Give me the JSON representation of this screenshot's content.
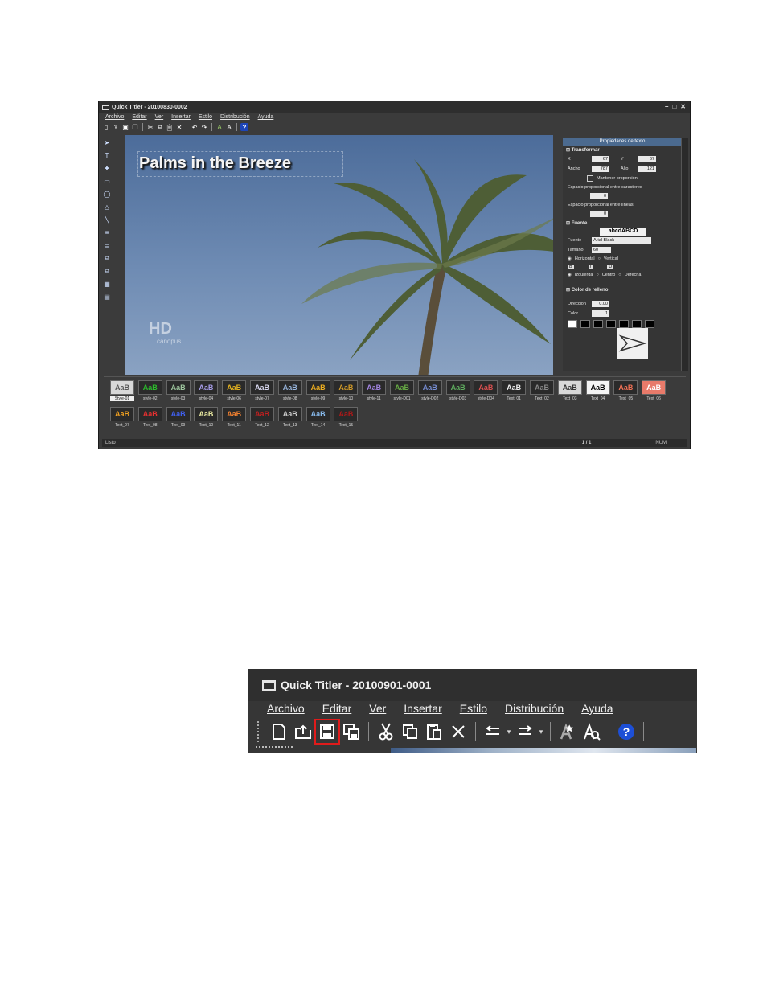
{
  "app1": {
    "title": "Quick Titler - 20100830-0002",
    "menu": [
      "Archivo",
      "Editar",
      "Ver",
      "Insertar",
      "Estilo",
      "Distribución",
      "Ayuda"
    ],
    "canvas_text": "Palms in the Breeze",
    "watermark_hd": "HD",
    "watermark_brand": "canopus",
    "props": {
      "header": "Propiedades de texto",
      "transform_label": "Transformar",
      "x_label": "X",
      "x_value": "67",
      "y_label": "Y",
      "y_value": "67",
      "width_label": "Ancho",
      "width_value": "787",
      "height_label": "Alto",
      "height_value": "121",
      "keep_ratio_label": "Mantener proporción",
      "char_spacing_label": "Espacio proporcional entre caracteres",
      "char_spacing_value": "0",
      "line_spacing_label": "Espacio proporcional entre líneas",
      "line_spacing_value": "0",
      "font_section": "Fuente",
      "font_sample": "abcdABCD",
      "font_label": "Fuente",
      "font_value": "Arial Black",
      "size_label": "Tamaño",
      "size_value": "60",
      "horizontal_label": "Horizontal",
      "vertical_label": "Vertical",
      "bold": "B",
      "italic": "I",
      "underline": "U",
      "left_label": "Izquierda",
      "center_label": "Centro",
      "right_label": "Derecha",
      "fill_section": "Color de relleno",
      "direction_label": "Dirección",
      "direction_value": "0.00",
      "color_label": "Color",
      "color_value": "1"
    },
    "styles_row1": [
      "Style-01",
      "style-02",
      "style-03",
      "style-04",
      "style-06",
      "style-07",
      "style-08",
      "style-09",
      "style-10",
      "style-11",
      "style-D01",
      "style-D02",
      "style-D03",
      "style-D04",
      "Text_01",
      "Text_02",
      "Text_03",
      "Text_04",
      "Text_05",
      "Text_06"
    ],
    "styles_row2": [
      "Text_07",
      "Text_08",
      "Text_09",
      "Text_10",
      "Text_11",
      "Text_12",
      "Text_13",
      "Text_14",
      "Text_15"
    ],
    "swatch_text": "AaB",
    "status_left": "Listo",
    "status_page": "1 / 1",
    "status_mode": "NUM"
  },
  "app2": {
    "title": "Quick Titler - 20100901-0001",
    "menu": [
      "Archivo",
      "Editar",
      "Ver",
      "Insertar",
      "Estilo",
      "Distribución",
      "Ayuda"
    ],
    "highlight_color": "#e01b1b",
    "toolbar_icons": [
      "new-icon",
      "open-icon",
      "save-icon",
      "save-as-icon",
      "cut-icon",
      "copy-icon",
      "paste-icon",
      "delete-icon",
      "undo-icon",
      "redo-icon",
      "text-style-icon",
      "font-icon",
      "help-icon"
    ]
  }
}
